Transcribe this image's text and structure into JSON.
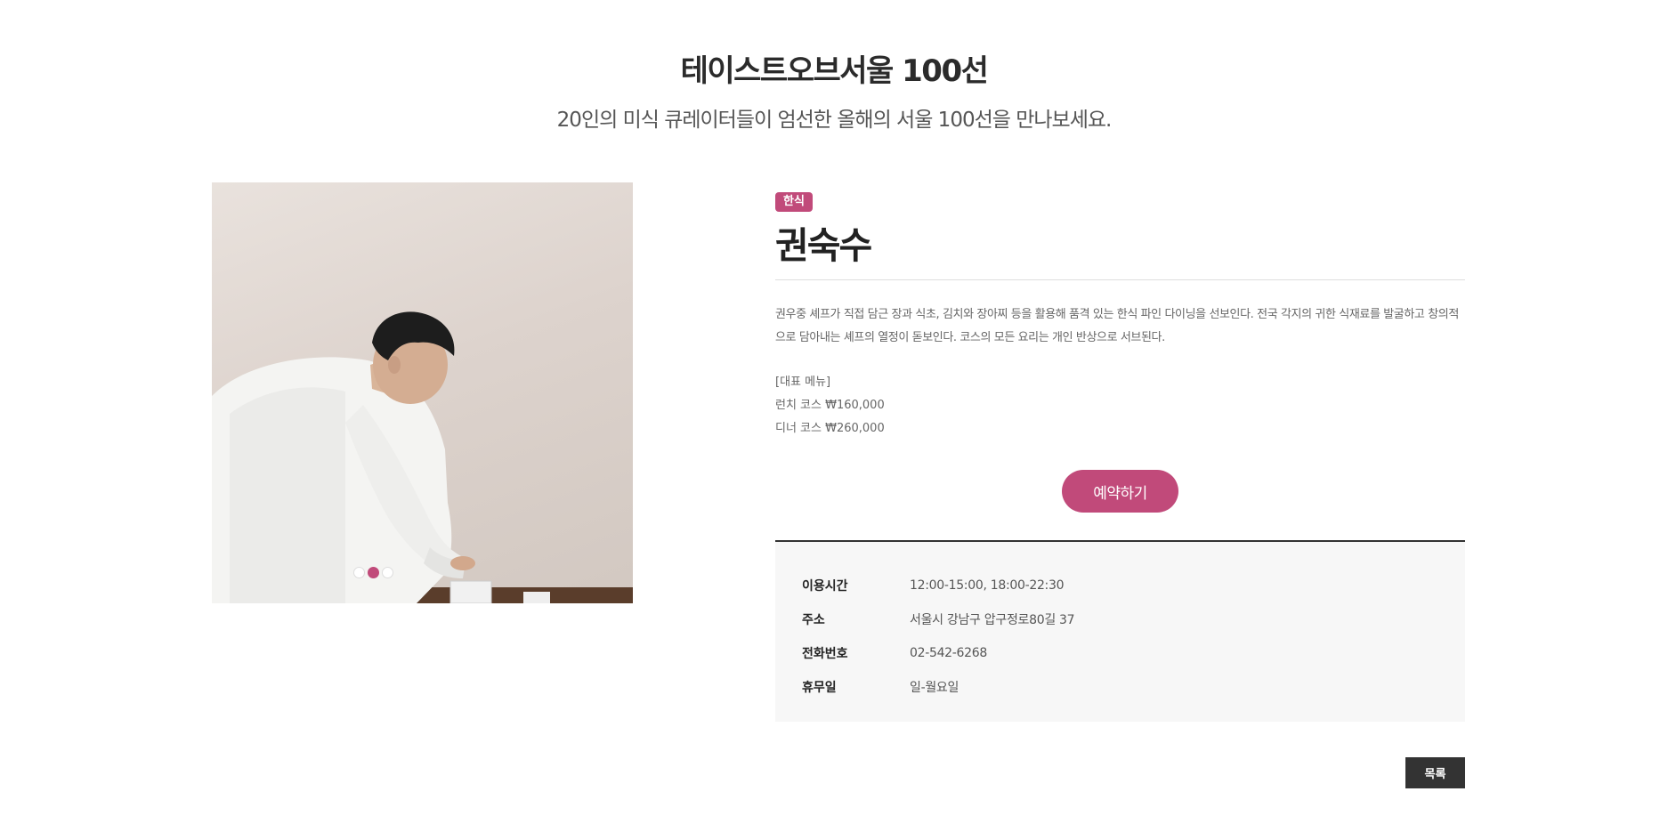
{
  "header": {
    "title": "테이스트오브서울 100선",
    "subtitle": "20인의 미식 큐레이터들이 엄선한 올해의 서울 100선을 만나보세요."
  },
  "gallery": {
    "slide_count": 3,
    "active_index": 1
  },
  "restaurant": {
    "category": "한식",
    "name": "권숙수",
    "description": "권우중 셰프가 직접 담근 장과 식초, 김치와 장아찌 등을 활용해 품격 있는 한식 파인 다이닝을 선보인다. 전국 각지의 귀한 식재료를 발굴하고 창의적으로 담아내는 셰프의 열정이 돋보인다. 코스의 모든 요리는 개인 반상으로 서브된다.",
    "menu_title": "[대표 메뉴]",
    "menu_items": [
      "런치 코스 ₩160,000",
      "디너 코스 ₩260,000"
    ],
    "reserve_label": "예약하기"
  },
  "details": [
    {
      "label": "이용시간",
      "value": "12:00-15:00, 18:00-22:30"
    },
    {
      "label": "주소",
      "value": "서울시 강남구 압구정로80길 37"
    },
    {
      "label": "전화번호",
      "value": "02-542-6268"
    },
    {
      "label": "휴무일",
      "value": "일-월요일"
    }
  ],
  "footer": {
    "list_label": "목록"
  },
  "colors": {
    "accent": "#c14a7a",
    "dark": "#333333",
    "panel_bg": "#f7f7f7"
  }
}
